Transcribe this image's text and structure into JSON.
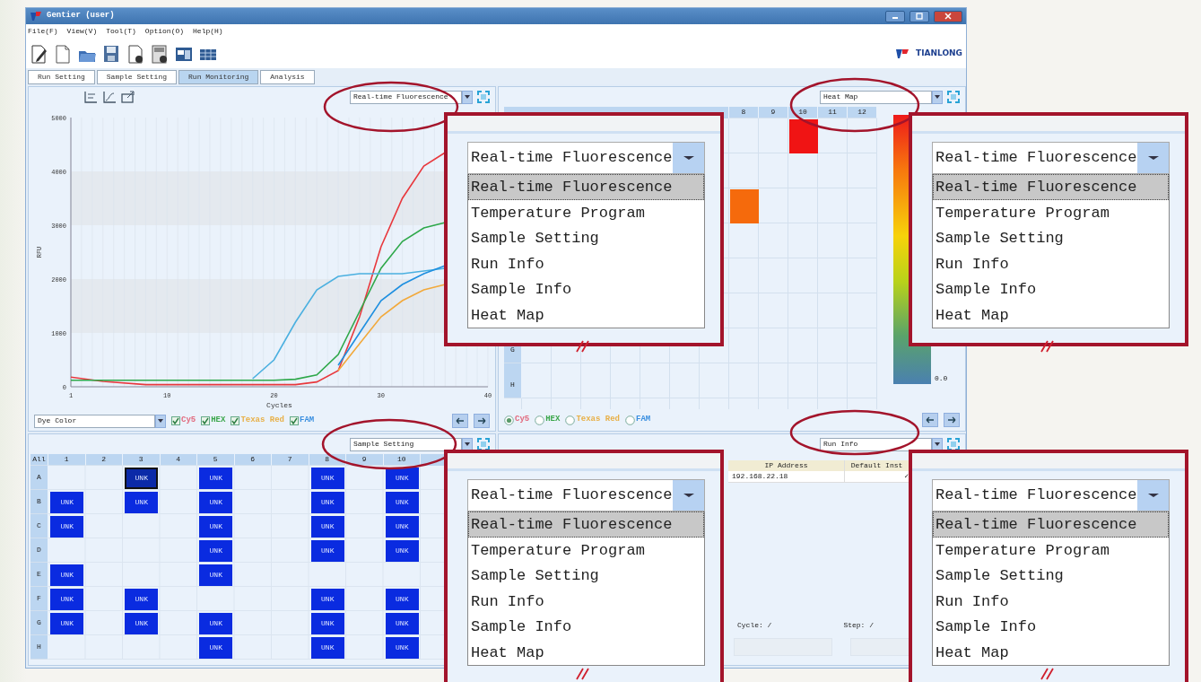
{
  "window": {
    "title": "Gentier (user)"
  },
  "menu": [
    "File(F)",
    "View(V)",
    "Tool(T)",
    "Option(O)",
    "Help(H)"
  ],
  "brand": "TIANLONG",
  "tabs": [
    {
      "label": "Run Setting",
      "selected": false
    },
    {
      "label": "Sample Setting",
      "selected": false
    },
    {
      "label": "Run Monitoring",
      "selected": true
    },
    {
      "label": "Analysis",
      "selected": false
    }
  ],
  "fluorescence_panel": {
    "view": "Real-time Fluorescence",
    "chart_data": {
      "type": "line",
      "xlabel": "Cycles",
      "ylabel": "RFU",
      "xlim": [
        1,
        40
      ],
      "ylim": [
        0,
        5000
      ],
      "xticks": [
        1,
        10,
        20,
        30,
        40
      ],
      "yticks": [
        0,
        1000,
        2000,
        3000,
        4000,
        5000
      ],
      "grid": true,
      "x": [
        1,
        4,
        8,
        12,
        16,
        18,
        20,
        22,
        24,
        26,
        28,
        30,
        32,
        34,
        36
      ],
      "series": [
        {
          "color": "#e8383d",
          "values": [
            180,
            100,
            40,
            40,
            40,
            40,
            40,
            40,
            90,
            300,
            1300,
            2600,
            3500,
            4100,
            4350
          ]
        },
        {
          "color": "#2ea84a",
          "values": [
            120,
            120,
            120,
            120,
            120,
            120,
            120,
            140,
            220,
            600,
            1400,
            2200,
            2700,
            2950,
            3050
          ]
        },
        {
          "color": "#f2a93b",
          "values": [
            null,
            null,
            null,
            null,
            null,
            null,
            null,
            null,
            null,
            300,
            800,
            1300,
            1600,
            1800,
            1900
          ]
        },
        {
          "color": "#4bb0e0",
          "values": [
            null,
            null,
            null,
            null,
            null,
            150,
            500,
            1200,
            1800,
            2050,
            2100,
            2100,
            2100,
            2150,
            2200
          ]
        },
        {
          "color": "#1e8fe0",
          "values": [
            null,
            null,
            null,
            null,
            null,
            null,
            null,
            null,
            null,
            400,
            1000,
            1600,
            1900,
            2100,
            2250
          ]
        }
      ]
    },
    "dye_select": "Dye Color",
    "dyes": [
      {
        "label": "Cy5",
        "color": "#e26a7e",
        "checked": true
      },
      {
        "label": "HEX",
        "color": "#3aa64a",
        "checked": true
      },
      {
        "label": "Texas Red",
        "color": "#e8b048",
        "checked": true
      },
      {
        "label": "FAM",
        "color": "#3a8fe0",
        "checked": true
      }
    ]
  },
  "heat_map_panel": {
    "view": "Heat Map",
    "columns": [
      "8",
      "9",
      "10",
      "11",
      "12"
    ],
    "rows": [
      {
        "wells": [
          {
            "kind": "empty"
          },
          {
            "kind": "empty"
          },
          {
            "kind": "value",
            "color": "#f01414"
          },
          {
            "kind": "empty"
          },
          {
            "kind": "empty"
          }
        ]
      },
      {
        "wells": [
          {
            "kind": "empty"
          },
          {
            "kind": "empty"
          },
          {
            "kind": "empty"
          },
          {
            "kind": "empty"
          },
          {
            "kind": "empty"
          }
        ]
      },
      {
        "wells": [
          {
            "kind": "value",
            "color": "#f56a0c"
          },
          {
            "kind": "empty"
          },
          {
            "kind": "empty"
          },
          {
            "kind": "empty"
          },
          {
            "kind": "empty"
          }
        ]
      },
      {
        "wells": [
          {
            "kind": "empty"
          },
          {
            "kind": "empty"
          },
          {
            "kind": "empty"
          },
          {
            "kind": "empty"
          },
          {
            "kind": "empty"
          }
        ]
      },
      {
        "wells": [
          {
            "kind": "empty"
          },
          {
            "kind": "empty"
          },
          {
            "kind": "empty"
          },
          {
            "kind": "empty"
          },
          {
            "kind": "empty"
          }
        ]
      },
      {
        "wells": [
          {
            "kind": "empty"
          },
          {
            "kind": "empty"
          },
          {
            "kind": "empty"
          },
          {
            "kind": "empty"
          },
          {
            "kind": "empty"
          }
        ]
      },
      {
        "label": "G",
        "wells": [
          {
            "kind": "empty"
          },
          {
            "kind": "empty"
          },
          {
            "kind": "empty"
          },
          {
            "kind": "empty"
          },
          {
            "kind": "empty"
          }
        ]
      },
      {
        "label": "H",
        "wells": [
          {
            "kind": "empty"
          },
          {
            "kind": "empty"
          },
          {
            "kind": "empty"
          },
          {
            "kind": "empty"
          },
          {
            "kind": "empty"
          }
        ]
      }
    ],
    "scale_label": "0.0",
    "dyes": [
      {
        "label": "Cy5",
        "color": "#e26a7e",
        "selected": true
      },
      {
        "label": "HEX",
        "color": "#3aa64a",
        "selected": false
      },
      {
        "label": "Texas Red",
        "color": "#e8b048",
        "selected": false
      },
      {
        "label": "FAM",
        "color": "#3a8fe0",
        "selected": false
      }
    ]
  },
  "sample_panel": {
    "view": "Sample Setting",
    "corner": "All",
    "columns": [
      "1",
      "2",
      "3",
      "4",
      "5",
      "6",
      "7",
      "8",
      "9",
      "10"
    ],
    "rows": [
      {
        "label": "A",
        "wells": [
          {
            "kind": "empty"
          },
          {
            "kind": "empty"
          },
          {
            "kind": "sample",
            "text": "UNK",
            "selected": true
          },
          {
            "kind": "empty"
          },
          {
            "kind": "sample",
            "text": "UNK",
            "selected": false
          },
          {
            "kind": "empty"
          },
          {
            "kind": "empty"
          },
          {
            "kind": "sample",
            "text": "UNK",
            "selected": false
          },
          {
            "kind": "empty"
          },
          {
            "kind": "sample",
            "text": "UNK",
            "selected": false
          }
        ]
      },
      {
        "label": "B",
        "wells": [
          {
            "kind": "sample",
            "text": "UNK",
            "selected": false
          },
          {
            "kind": "empty"
          },
          {
            "kind": "sample",
            "text": "UNK",
            "selected": false
          },
          {
            "kind": "empty"
          },
          {
            "kind": "sample",
            "text": "UNK",
            "selected": false
          },
          {
            "kind": "empty"
          },
          {
            "kind": "empty"
          },
          {
            "kind": "sample",
            "text": "UNK",
            "selected": false
          },
          {
            "kind": "empty"
          },
          {
            "kind": "sample",
            "text": "UNK",
            "selected": false
          }
        ]
      },
      {
        "label": "C",
        "wells": [
          {
            "kind": "sample",
            "text": "UNK",
            "selected": false
          },
          {
            "kind": "empty"
          },
          {
            "kind": "empty"
          },
          {
            "kind": "empty"
          },
          {
            "kind": "sample",
            "text": "UNK",
            "selected": false
          },
          {
            "kind": "empty"
          },
          {
            "kind": "empty"
          },
          {
            "kind": "sample",
            "text": "UNK",
            "selected": false
          },
          {
            "kind": "empty"
          },
          {
            "kind": "sample",
            "text": "UNK",
            "selected": false
          }
        ]
      },
      {
        "label": "D",
        "wells": [
          {
            "kind": "empty"
          },
          {
            "kind": "empty"
          },
          {
            "kind": "empty"
          },
          {
            "kind": "empty"
          },
          {
            "kind": "sample",
            "text": "UNK",
            "selected": false
          },
          {
            "kind": "empty"
          },
          {
            "kind": "empty"
          },
          {
            "kind": "sample",
            "text": "UNK",
            "selected": false
          },
          {
            "kind": "empty"
          },
          {
            "kind": "sample",
            "text": "UNK",
            "selected": false
          }
        ]
      },
      {
        "label": "E",
        "wells": [
          {
            "kind": "sample",
            "text": "UNK",
            "selected": false
          },
          {
            "kind": "empty"
          },
          {
            "kind": "empty"
          },
          {
            "kind": "empty"
          },
          {
            "kind": "sample",
            "text": "UNK",
            "selected": false
          },
          {
            "kind": "empty"
          },
          {
            "kind": "empty"
          },
          {
            "kind": "empty"
          },
          {
            "kind": "empty"
          },
          {
            "kind": "empty"
          }
        ]
      },
      {
        "label": "F",
        "wells": [
          {
            "kind": "sample",
            "text": "UNK",
            "selected": false
          },
          {
            "kind": "empty"
          },
          {
            "kind": "sample",
            "text": "UNK",
            "selected": false
          },
          {
            "kind": "empty"
          },
          {
            "kind": "empty"
          },
          {
            "kind": "empty"
          },
          {
            "kind": "empty"
          },
          {
            "kind": "sample",
            "text": "UNK",
            "selected": false
          },
          {
            "kind": "empty"
          },
          {
            "kind": "sample",
            "text": "UNK",
            "selected": false
          }
        ]
      },
      {
        "label": "G",
        "wells": [
          {
            "kind": "sample",
            "text": "UNK",
            "selected": false
          },
          {
            "kind": "empty"
          },
          {
            "kind": "sample",
            "text": "UNK",
            "selected": false
          },
          {
            "kind": "empty"
          },
          {
            "kind": "sample",
            "text": "UNK",
            "selected": false
          },
          {
            "kind": "empty"
          },
          {
            "kind": "empty"
          },
          {
            "kind": "sample",
            "text": "UNK",
            "selected": false
          },
          {
            "kind": "empty"
          },
          {
            "kind": "sample",
            "text": "UNK",
            "selected": false
          }
        ]
      },
      {
        "label": "H",
        "wells": [
          {
            "kind": "empty"
          },
          {
            "kind": "empty"
          },
          {
            "kind": "empty"
          },
          {
            "kind": "empty"
          },
          {
            "kind": "sample",
            "text": "UNK",
            "selected": false
          },
          {
            "kind": "empty"
          },
          {
            "kind": "empty"
          },
          {
            "kind": "sample",
            "text": "UNK",
            "selected": false
          },
          {
            "kind": "empty"
          },
          {
            "kind": "sample",
            "text": "UNK",
            "selected": false
          }
        ]
      }
    ]
  },
  "run_info_panel": {
    "view": "Run Info",
    "columns": [
      "IP Address",
      "Default Inst"
    ],
    "rows": [
      [
        "192.168.22.18",
        "✓"
      ]
    ],
    "cycle": "Cycle: /",
    "step": "Step: /",
    "buttons": [
      {
        "disabled": true
      },
      {
        "disabled": true
      }
    ]
  },
  "callouts": [
    {
      "value": "Real-time Fluorescence",
      "options": [
        {
          "label": "Real-time Fluorescence",
          "selected": true
        },
        {
          "label": "Temperature Program",
          "selected": false
        },
        {
          "label": "Sample Setting",
          "selected": false
        },
        {
          "label": "Run Info",
          "selected": false
        },
        {
          "label": "Sample Info",
          "selected": false
        },
        {
          "label": "Heat Map",
          "selected": false
        }
      ]
    },
    {
      "value": "Real-time Fluorescence",
      "options": [
        {
          "label": "Real-time Fluorescence",
          "selected": true
        },
        {
          "label": "Temperature Program",
          "selected": false
        },
        {
          "label": "Sample Setting",
          "selected": false
        },
        {
          "label": "Run Info",
          "selected": false
        },
        {
          "label": "Sample Info",
          "selected": false
        },
        {
          "label": "Heat Map",
          "selected": false
        }
      ]
    },
    {
      "value": "Real-time Fluorescence",
      "options": [
        {
          "label": "Real-time Fluorescence",
          "selected": true
        },
        {
          "label": "Temperature Program",
          "selected": false
        },
        {
          "label": "Sample Setting",
          "selected": false
        },
        {
          "label": "Run Info",
          "selected": false
        },
        {
          "label": "Sample Info",
          "selected": false
        },
        {
          "label": "Heat Map",
          "selected": false
        }
      ]
    },
    {
      "value": "Real-time Fluorescence",
      "options": [
        {
          "label": "Real-time Fluorescence",
          "selected": true
        },
        {
          "label": "Temperature Program",
          "selected": false
        },
        {
          "label": "Sample Setting",
          "selected": false
        },
        {
          "label": "Run Info",
          "selected": false
        },
        {
          "label": "Sample Info",
          "selected": false
        },
        {
          "label": "Heat Map",
          "selected": false
        }
      ]
    }
  ]
}
